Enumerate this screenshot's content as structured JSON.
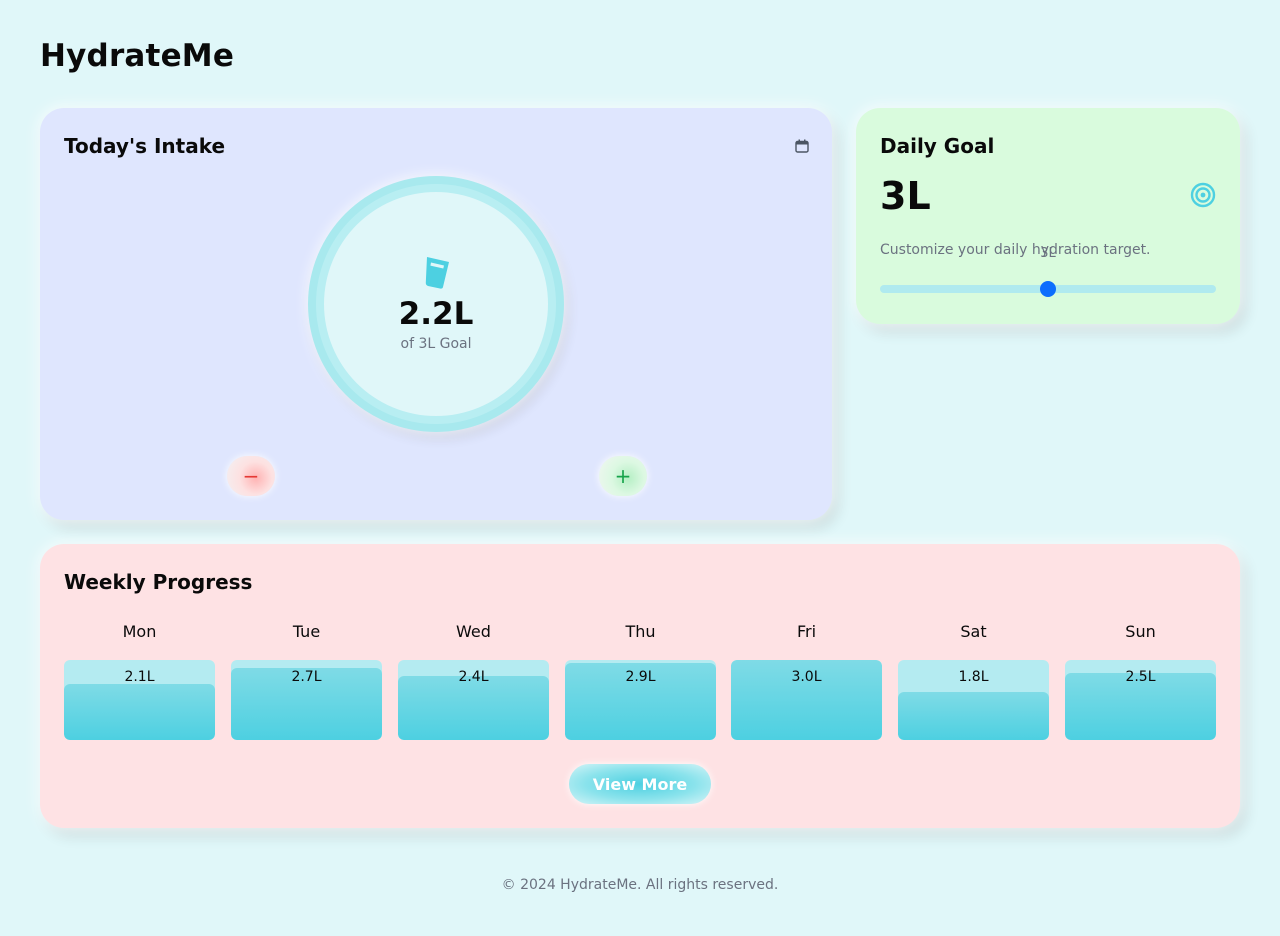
{
  "app": {
    "title": "HydrateMe"
  },
  "intake": {
    "title": "Today's Intake",
    "value": "2.2L",
    "subtitle": "of 3L Goal",
    "calendar_icon": "calendar-icon",
    "glass_icon": "water-glass-icon",
    "decrease_label": "−",
    "increase_label": "+"
  },
  "goal": {
    "title": "Daily Goal",
    "value": "3L",
    "icon": "target-icon",
    "description": "Customize your daily hydration target.",
    "slider_label": "3L",
    "slider_fraction": 0.5,
    "accent_color": "#4dd0e1",
    "thumb_color": "#0d6efd"
  },
  "weekly": {
    "title": "Weekly Progress",
    "days": [
      {
        "name": "Mon",
        "value": "2.1L",
        "liters": 2.1
      },
      {
        "name": "Tue",
        "value": "2.7L",
        "liters": 2.7
      },
      {
        "name": "Wed",
        "value": "2.4L",
        "liters": 2.4
      },
      {
        "name": "Thu",
        "value": "2.9L",
        "liters": 2.9
      },
      {
        "name": "Fri",
        "value": "3.0L",
        "liters": 3.0
      },
      {
        "name": "Sat",
        "value": "1.8L",
        "liters": 1.8
      },
      {
        "name": "Sun",
        "value": "2.5L",
        "liters": 2.5
      }
    ],
    "max_liters": 3.0,
    "view_more_label": "View More"
  },
  "footer": {
    "text": "© 2024 HydrateMe. All rights reserved."
  }
}
